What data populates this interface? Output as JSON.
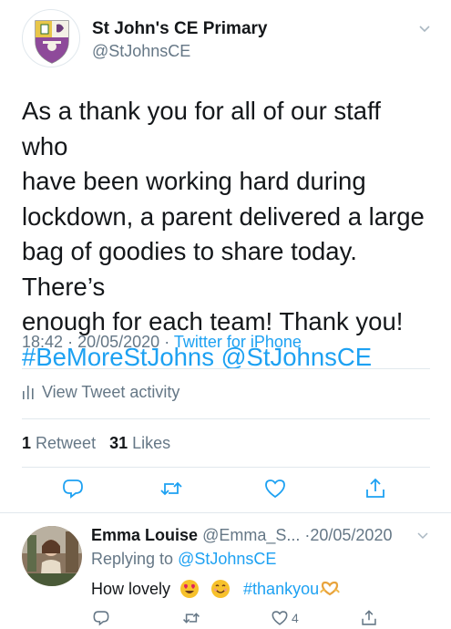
{
  "tweet": {
    "author": {
      "display_name": "St John's CE Primary",
      "handle": "@StJohnsCE"
    },
    "text_lines": [
      "As a thank you for all of our staff who",
      "have been working hard during",
      "lockdown, a parent delivered a large",
      "bag of goodies to share today. There’s",
      "enough for each team! Thank you!"
    ],
    "hashtag": "#BeMoreStJohns",
    "mention": "@StJohnsCE",
    "time": "18:42",
    "separator": "·",
    "date": "20/05/2020",
    "source": "Twitter for iPhone",
    "activity_label": "View Tweet activity",
    "retweet_count": "1",
    "retweet_label": "Retweet",
    "likes_count": "31",
    "likes_label": "Likes"
  },
  "reply": {
    "display_name": "Emma Louise",
    "handle": "@Emma_S...",
    "separator": "·",
    "date": "20/05/2020",
    "replying_prefix": "Replying to",
    "replying_to": "@StJohnsCE",
    "text": "How lovely",
    "hashtag": "#thankyou",
    "like_count": "4"
  },
  "icons": {
    "caret": "chevron-down-icon",
    "activity": "bar-chart-icon",
    "reply": "comment-icon",
    "retweet": "retweet-icon",
    "like": "heart-icon",
    "share": "share-icon"
  },
  "colors": {
    "link": "#1da1f2",
    "secondary": "#657786",
    "text": "#14171a"
  }
}
